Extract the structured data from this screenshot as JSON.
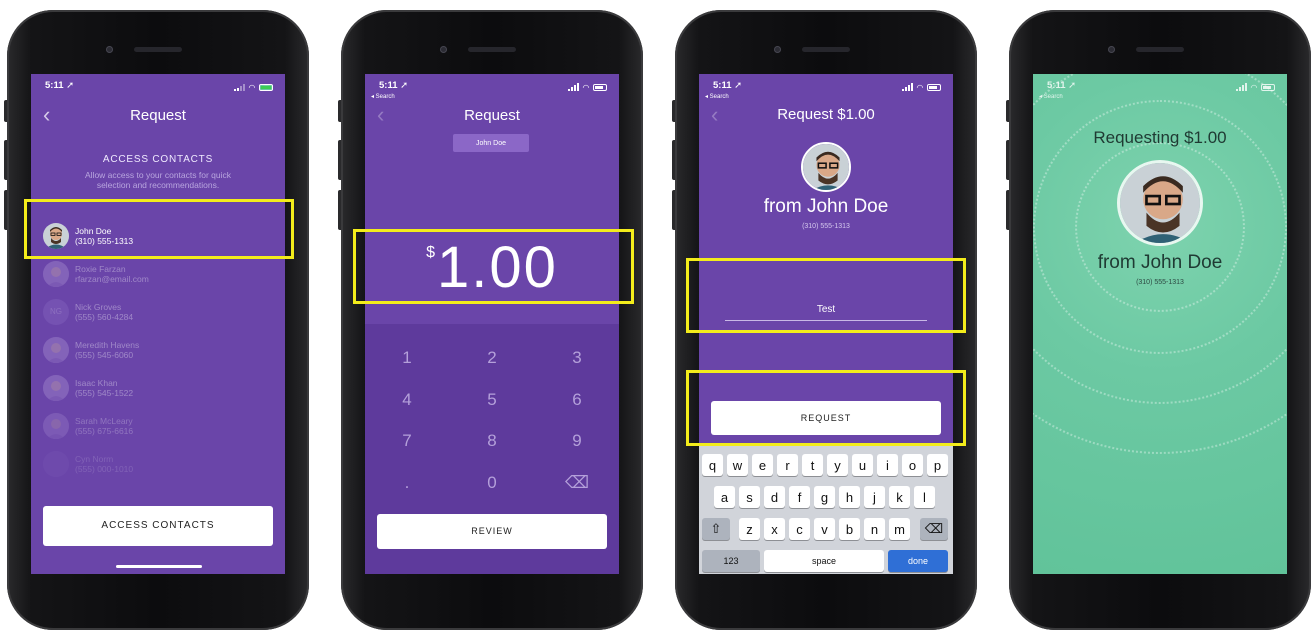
{
  "status": {
    "time": "5:11",
    "back_search": "◂ Search"
  },
  "screen1": {
    "title": "Request",
    "header": "ACCESS CONTACTS",
    "subtext": "Allow access to your contacts for quick selection and recommendations.",
    "contacts": [
      {
        "name": "John Doe",
        "detail": "(310) 555-1313",
        "initials": ""
      },
      {
        "name": "Roxie Farzan",
        "detail": "rfarzan@email.com",
        "initials": ""
      },
      {
        "name": "Nick Groves",
        "detail": "(555) 560-4284",
        "initials": "NG"
      },
      {
        "name": "Meredith Havens",
        "detail": "(555) 545-6060",
        "initials": ""
      },
      {
        "name": "Isaac Khan",
        "detail": "(555) 545-1522",
        "initials": ""
      },
      {
        "name": "Sarah McLeary",
        "detail": "(555) 675-6616",
        "initials": ""
      },
      {
        "name": "Cyn Norm",
        "detail": "(555) 000-1010",
        "initials": ""
      }
    ],
    "button": "ACCESS CONTACTS"
  },
  "screen2": {
    "title": "Request",
    "chip": "John Doe",
    "currency": "$",
    "amount": "1.00",
    "keys": [
      "1",
      "2",
      "3",
      "4",
      "5",
      "6",
      "7",
      "8",
      "9",
      ".",
      "0",
      "⌫"
    ],
    "button": "REVIEW"
  },
  "screen3": {
    "title": "Request $1.00",
    "from": "from John Doe",
    "phone": "(310) 555-1313",
    "note": "Test",
    "button": "REQUEST",
    "kb_row1": [
      "q",
      "w",
      "e",
      "r",
      "t",
      "y",
      "u",
      "i",
      "o",
      "p"
    ],
    "kb_row2": [
      "a",
      "s",
      "d",
      "f",
      "g",
      "h",
      "j",
      "k",
      "l"
    ],
    "kb_row3": [
      "z",
      "x",
      "c",
      "v",
      "b",
      "n",
      "m"
    ],
    "kb_shift": "⇧",
    "kb_delete": "⌫",
    "kb_123": "123",
    "kb_space": "space",
    "kb_done": "done"
  },
  "screen4": {
    "title": "Requesting $1.00",
    "from": "from John Doe",
    "phone": "(310) 555-1313"
  },
  "colors": {
    "purple": "#6a45a9",
    "highlight": "#f3ec1b",
    "green": "#6cc9a3",
    "done": "#2f6fd6"
  }
}
